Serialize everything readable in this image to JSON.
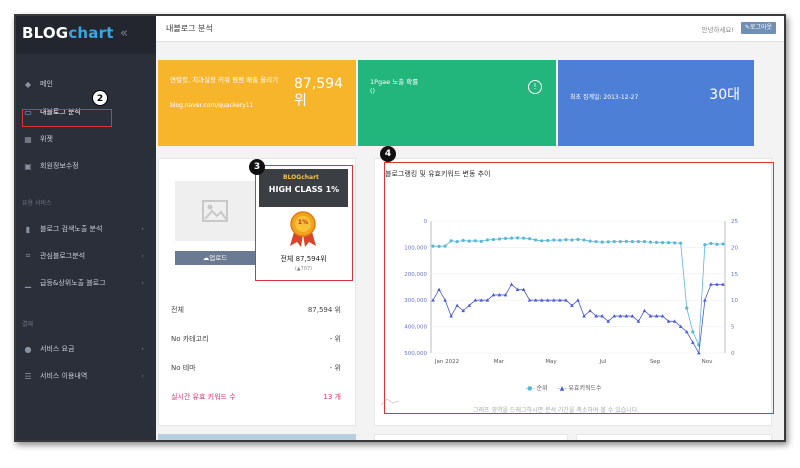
{
  "app": {
    "logo_main": "BLOG",
    "logo_accent": "chart",
    "collapse_glyph": "«"
  },
  "sidebar": {
    "items": [
      {
        "label": "메인",
        "icon": "diamond-icon"
      },
      {
        "label": "내블로그 분석",
        "icon": "toggle-icon"
      },
      {
        "label": "위젯",
        "icon": "widget-icon"
      },
      {
        "label": "회원정보수정",
        "icon": "id-card-icon"
      }
    ],
    "section1": "유용 서비스",
    "tools": [
      {
        "label": "블로그 검색노출 분석",
        "icon": "chart-bars-icon"
      },
      {
        "label": "관심블로그분석",
        "icon": "bracket-icon"
      },
      {
        "label": "급등&상위노출 블로그",
        "icon": "bar-chart-icon"
      }
    ],
    "section2": "결제",
    "billing": [
      {
        "label": "서비스 요금",
        "icon": "coin-icon"
      },
      {
        "label": "서비스 이용내역",
        "icon": "list-icon"
      }
    ]
  },
  "topbar": {
    "title": "내블로그 분석",
    "greeting": "안녕하세요!",
    "logout": "✎로그아웃"
  },
  "cards": {
    "yellow_label": "연탈킷, 치과실장 키워 펌펌 매출 올리기",
    "yellow_url": "blog.naver.com/quackery11",
    "yellow_rank_num": "87,594",
    "yellow_rank_unit": "위",
    "green_label": "1Pgae 노출 확률",
    "green_paren": "()",
    "green_alert": "!",
    "blue_label": "최초 집계일: 2013-12-27",
    "blue_big": "30대"
  },
  "profile": {
    "upload": "업로드",
    "badge_brand": "BLOGchart",
    "badge_class": "HIGH CLASS 1%",
    "medal_text": "1%",
    "total_rank": "전체 87,594위",
    "rank_change": "(▲707)"
  },
  "stats": [
    {
      "label": "전체",
      "value": "87,594 위",
      "highlight": false
    },
    {
      "label": "No 카테고리",
      "value": "- 위",
      "highlight": false
    },
    {
      "label": "No 테마",
      "value": "- 위",
      "highlight": false
    },
    {
      "label": "실시간 유효 키워드 수",
      "value": "13 개",
      "highlight": true
    }
  ],
  "chart": {
    "title": "블로그랭킹 및 유효키워드 변동 추이",
    "drag_tip": "그래프 영역을 드래그하시면 분석 기간을 축소하여 볼 수 있습니다.",
    "legend_rank": "순위",
    "legend_kw": "유효키워드수"
  },
  "callouts": {
    "c2": "2",
    "c3": "3",
    "c4": "4"
  },
  "chart_data": {
    "type": "line",
    "x_ticks": [
      "Jan 2022",
      "Mar",
      "May",
      "Jul",
      "Sep",
      "Nov"
    ],
    "y_left_ticks": [
      "0",
      "100,000",
      "200,000",
      "300,000",
      "400,000",
      "500,000"
    ],
    "y_left_range": [
      0,
      500000
    ],
    "y_left_inverted": true,
    "y_right_ticks": [
      "0",
      "5",
      "10",
      "15",
      "20",
      "25"
    ],
    "y_right_range": [
      0,
      25
    ],
    "colors": {
      "rank": "#5bb8d8",
      "keywords": "#4a5bd4"
    },
    "series": [
      {
        "name": "순위",
        "axis": "left",
        "values": [
          95000,
          96000,
          95000,
          75000,
          78000,
          74000,
          76000,
          75000,
          77000,
          72000,
          70000,
          68000,
          66000,
          65000,
          64000,
          65000,
          67000,
          72000,
          75000,
          74000,
          72000,
          73000,
          71000,
          72000,
          70000,
          72000,
          76000,
          78000,
          80000,
          79000,
          78000,
          78000,
          77000,
          78000,
          78000,
          78000,
          80000,
          81000,
          82000,
          82000,
          83000,
          84000,
          330000,
          420000,
          470000,
          90000,
          85000,
          88000,
          87000
        ]
      },
      {
        "name": "유효키워드수",
        "axis": "right",
        "values": [
          10,
          12,
          10,
          7,
          9,
          8,
          9,
          10,
          10,
          10,
          11,
          11,
          11,
          13,
          12,
          12,
          10,
          10,
          10,
          10,
          10,
          10,
          10,
          9,
          10,
          7,
          8,
          7,
          7,
          6,
          7,
          7,
          7,
          7,
          6,
          8,
          7,
          7,
          7,
          6,
          6,
          5,
          4,
          2,
          0,
          10,
          13,
          13,
          13
        ]
      }
    ]
  }
}
